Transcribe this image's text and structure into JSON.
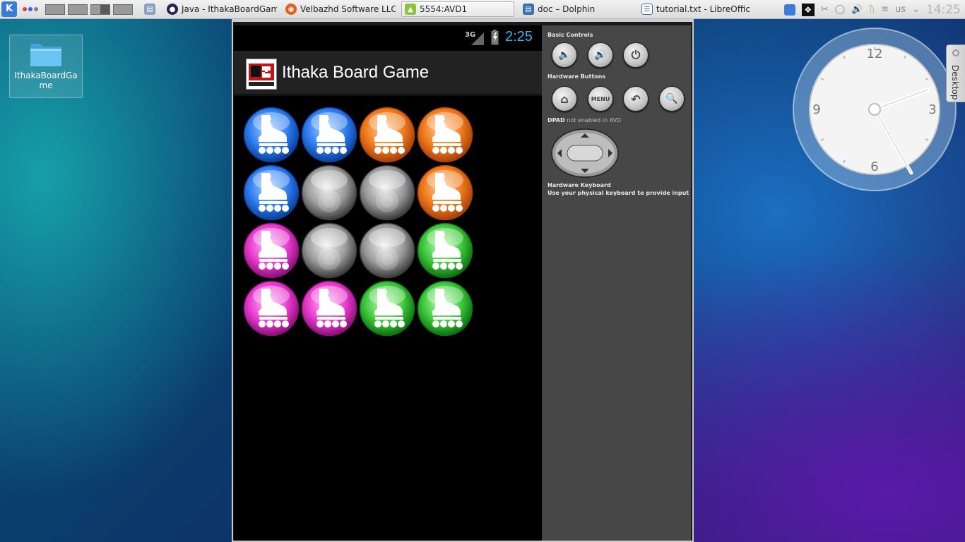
{
  "taskbar": {
    "tasks": [
      {
        "label": "Java - IthakaBoardGam",
        "icon": "eclipse-icon"
      },
      {
        "label": "Velbazhd Software LLC",
        "icon": "firefox-icon"
      },
      {
        "label": "5554:AVD1",
        "icon": "android-icon"
      },
      {
        "label": "doc – Dolphin",
        "icon": "dolphin-icon"
      },
      {
        "label": "tutorial.txt - LibreOffic",
        "icon": "libreoffice-icon"
      }
    ],
    "keyboard_layout": "us",
    "clock": "14:25"
  },
  "desktop": {
    "icon_label": "IthakaBoardGame",
    "side_tab_label": "Desktop"
  },
  "clock_widget": {
    "numerals": [
      "12",
      "3",
      "6",
      "9"
    ]
  },
  "emulator": {
    "status_bar": {
      "network": "3G",
      "time": "2:25"
    },
    "app_title": "Ithaka Board Game",
    "board": {
      "rows": [
        [
          "blue",
          "blue",
          "orange",
          "orange"
        ],
        [
          "blue",
          "gray",
          "gray",
          "orange"
        ],
        [
          "magenta",
          "gray",
          "gray",
          "green"
        ],
        [
          "magenta",
          "magenta",
          "green",
          "green"
        ]
      ],
      "piece_icon": "inline-skate-icon"
    },
    "controls": {
      "basic_controls_label": "Basic Controls",
      "hardware_buttons_label": "Hardware Buttons",
      "menu_label": "MENU",
      "dpad_label_bold": "DPAD",
      "dpad_label_rest": "not enabled in AVD",
      "keyboard_title": "Hardware Keyboard",
      "keyboard_hint": "Use your physical keyboard to provide input"
    }
  },
  "colors": {
    "blue": [
      "#a8d2ff",
      "#2f7df0",
      "#0b3e9e"
    ],
    "orange": [
      "#ffd0a0",
      "#f07a1a",
      "#a8400a"
    ],
    "gray": [
      "#f0f0f0",
      "#9a9a9a",
      "#3c3c3c"
    ],
    "magenta": [
      "#ffc0f4",
      "#e83ad0",
      "#8c1078"
    ],
    "green": [
      "#c8ffc0",
      "#3cc83a",
      "#0e7010"
    ],
    "status_time": "#33b5e5"
  }
}
